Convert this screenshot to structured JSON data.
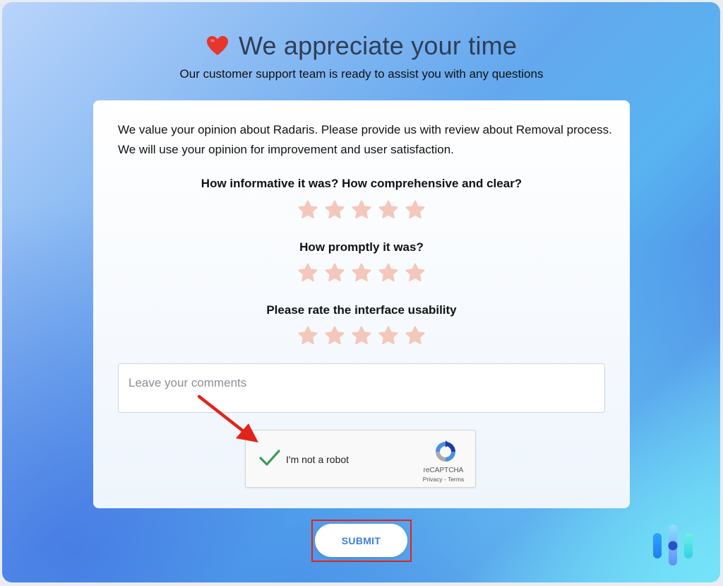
{
  "header": {
    "title": "We appreciate your time",
    "subtitle": "Our customer support team is ready to assist you with any questions",
    "heart_color": "#e7362c",
    "title_color": "#2f3e56"
  },
  "form": {
    "intro": "We value your opinion about Radaris. Please provide us with review about Removal process. We will use your opinion for improvement and user satisfaction.",
    "questions": [
      {
        "label": "How informative it was? How comprehensive and clear?",
        "stars": 5,
        "rating": 0
      },
      {
        "label": "How promptly it was?",
        "stars": 5,
        "rating": 0
      },
      {
        "label": "Please rate the interface usability",
        "stars": 5,
        "rating": 0
      }
    ],
    "star_color": "#f4c7bb",
    "comments": {
      "placeholder": "Leave your comments",
      "value": ""
    }
  },
  "captcha": {
    "label": "I'm not a robot",
    "checked": true,
    "check_color": "#3c9a58",
    "brand": "reCAPTCHA",
    "links": "Privacy - Terms"
  },
  "annotation": {
    "arrow_color": "#e2231a",
    "highlight_color": "#e2231a"
  },
  "submit": {
    "label": "SUBMIT",
    "color": "#3f7de0"
  }
}
